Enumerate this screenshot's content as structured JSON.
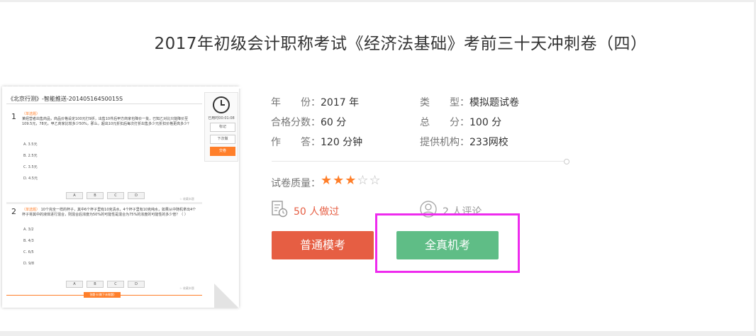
{
  "title": "2017年初级会计职称考试《经济法基础》考前三十天冲刺卷（四）",
  "preview": {
    "header": "《北京行测》-智能推送-20140516450015S",
    "elapsed": "已用时00:01:08",
    "side_buttons": [
      "标记",
      "下次做",
      "交卷"
    ],
    "questions": [
      {
        "num": "1",
        "tag": "（单选题）",
        "text": "某经营者出售商品，商品价格设定100元打9折，出售10件后甲方商家也降价一批，已知乙对比只能降价至109.5元，78元，甲乙商家比较多少50%，那么，超出10元折扣后每次打折出售多少元折扣价格更高多少？",
        "options": [
          "A. 3.5元",
          "B. 2.5元",
          "C. 3.5元",
          "D. 4.5元"
        ]
      },
      {
        "num": "2",
        "tag": "（单选题）",
        "text": "10个完全一样的杯子，其中6个杯子里有10克清水，4个杯子里有10克纯水，如果从中随机拿出4个杯子将其中的液体进行混合，则混合后浓度为50%的可能性是混合为75%的浓度的可能性的多少倍？（    ）",
        "options": [
          "A. 3/2",
          "B. 4/3",
          "C. 6/5",
          "D. 9/8"
        ]
      }
    ],
    "answer_choices": [
      "A",
      "B",
      "C",
      "D"
    ],
    "favorite": "☆ 收藏本题",
    "submit": "答题卡(剩下未做题)"
  },
  "info": {
    "year_label": "年　　份：",
    "year": "2017 年",
    "type_label": "类　　型：",
    "type": "模拟题试卷",
    "pass_label": "合格分数：",
    "pass": "60 分",
    "total_label": "总　　分：",
    "total": "100 分",
    "time_label": "作　　答：",
    "time": "120 分钟",
    "provider_label": "提供机构：",
    "provider": "233网校"
  },
  "quality": {
    "label": "试卷质量：",
    "stars_filled": 3,
    "stars_total": 5,
    "star_on": "★★★",
    "star_off": "☆☆"
  },
  "stats": {
    "done": "50 人做过",
    "comments": "2 人评论"
  },
  "buttons": {
    "practice": "普通模考",
    "exam": "全真机考"
  },
  "colors": {
    "accent": "#ff7f2a",
    "practice_button": "#e65e43",
    "exam_button": "#5fbd86",
    "highlight": "#ee2bee"
  }
}
